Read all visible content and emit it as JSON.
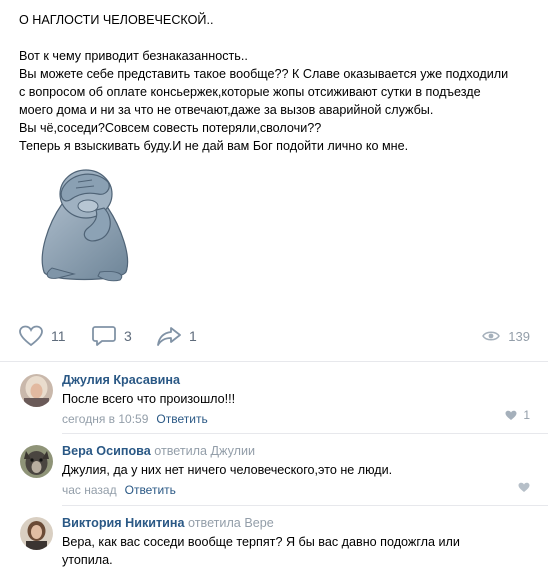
{
  "post": {
    "lines": [
      "О НАГЛОСТИ ЧЕЛОВЕЧЕСКОЙ..",
      "",
      "Вот к чему приводит безнаказанность..",
      "Вы можете себе представить такое вообще?? К Славе оказывается уже подходили",
      "с вопросом об оплате консьержек,которые жопы отсиживают сутки в подъезде",
      "моего дома и ни за что не отвечают,даже за вызов аварийной службы.",
      "Вы чё,соседи?Совсем совесть потеряли,сволочи??",
      "Теперь я взыскивать буду.И не дай вам Бог подойти лично ко мне."
    ],
    "sticker_icon": "facepalm-seal-sticker"
  },
  "actions": {
    "likes": "11",
    "comments": "3",
    "shares": "1",
    "views": "139"
  },
  "colors": {
    "link": "#2a5885",
    "muted": "#939ea9",
    "icon": "#5b6b7e",
    "divider": "#e7e8ec"
  },
  "comments": [
    {
      "author": "Джулия Красавина",
      "replied_prefix": "",
      "replied_to": "",
      "text": "После всего что произошло!!!",
      "time": "сегодня в 10:59",
      "reply_label": "Ответить",
      "likes": "1"
    },
    {
      "author": "Вера Осипова",
      "replied_prefix": "ответила",
      "replied_to": "Джулии",
      "text": "Джулия, да у них нет ничего человеческого,это не люди.",
      "time": "час назад",
      "reply_label": "Ответить",
      "likes": ""
    },
    {
      "author": "Виктория Никитина",
      "replied_prefix": "ответила",
      "replied_to": "Вере",
      "text_lines": [
        "Вера, как вас соседи вообще терпят? Я бы вас давно подожгла или",
        "утопила."
      ]
    }
  ]
}
